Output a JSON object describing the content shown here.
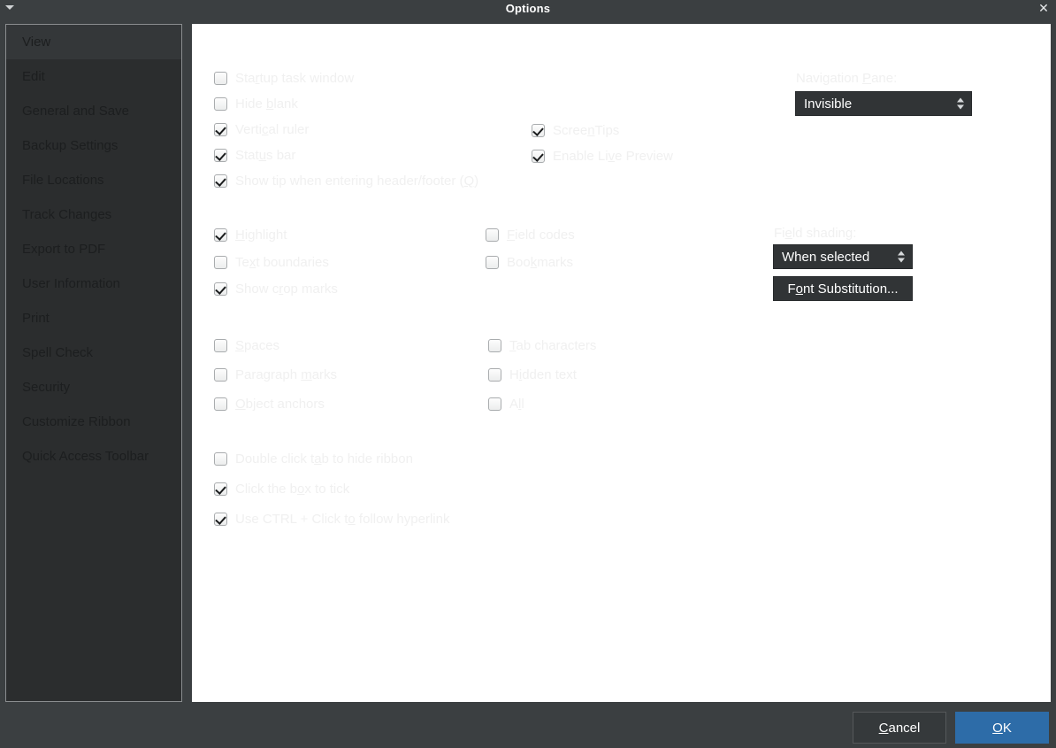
{
  "window": {
    "title": "Options",
    "menu_caret_icon": "chevron-down-icon",
    "close_icon": "close-icon",
    "accent_color": "#2d6ca8",
    "titlebar_color": "#3b3f41",
    "panel_color": "#ffffff",
    "sidebar_color": "#2b2d2e"
  },
  "sidebar": {
    "items": [
      {
        "label": "View",
        "selected": true
      },
      {
        "label": "Edit",
        "selected": false
      },
      {
        "label": "General and Save",
        "selected": false
      },
      {
        "label": "Backup Settings",
        "selected": false
      },
      {
        "label": "File Locations",
        "selected": false
      },
      {
        "label": "Track Changes",
        "selected": false
      },
      {
        "label": "Export to PDF",
        "selected": false
      },
      {
        "label": "User Information",
        "selected": false
      },
      {
        "label": "Print",
        "selected": false
      },
      {
        "label": "Spell Check",
        "selected": false
      },
      {
        "label": "Security",
        "selected": false
      },
      {
        "label": "Customize Ribbon",
        "selected": false
      },
      {
        "label": "Quick Access Toolbar",
        "selected": false
      }
    ]
  },
  "view_panel": {
    "group1_left": [
      {
        "label": "Startup task window",
        "accel": "r",
        "checked": false
      },
      {
        "label": "Hide blank",
        "accel": "b",
        "checked": false
      },
      {
        "label": "Vertical ruler",
        "accel": "c",
        "checked": true
      },
      {
        "label": "Status bar",
        "accel": "u",
        "checked": true
      },
      {
        "label": "Show tip when entering header/footer (Q)",
        "accel": "Q",
        "checked": true
      }
    ],
    "group1_right": [
      {
        "label": "ScreenTips",
        "accel": "n",
        "checked": true
      },
      {
        "label": "Enable Live Preview",
        "accel": "v",
        "checked": true
      }
    ],
    "group2_left": [
      {
        "label": "Highlight",
        "accel": "H",
        "checked": true
      },
      {
        "label": "Text boundaries",
        "accel": "x",
        "checked": false
      },
      {
        "label": "Show crop marks",
        "accel": "r",
        "checked": true
      }
    ],
    "group2_right": [
      {
        "label": "Field codes",
        "accel": "F",
        "checked": false
      },
      {
        "label": "Bookmarks",
        "accel": "k",
        "checked": false
      }
    ],
    "group3_left": [
      {
        "label": "Spaces",
        "accel": "S",
        "checked": false
      },
      {
        "label": "Paragraph marks",
        "accel": "m",
        "checked": false
      },
      {
        "label": "Object anchors",
        "accel": "O",
        "checked": false
      }
    ],
    "group3_right": [
      {
        "label": "Tab characters",
        "accel": "T",
        "checked": false
      },
      {
        "label": "Hidden text",
        "accel": "i",
        "checked": false
      },
      {
        "label": "All",
        "accel": "l",
        "checked": false
      }
    ],
    "group4": [
      {
        "label": "Double click tab to hide ribbon",
        "accel": "a",
        "checked": false
      },
      {
        "label": "Click the box to tick",
        "accel": "o",
        "checked": true
      },
      {
        "label": "Use CTRL + Click to follow hyperlink",
        "accel": "o",
        "checked": true
      }
    ],
    "navigation_pane": {
      "label": "Navigation Pane:",
      "accel": "P",
      "value": "Invisible"
    },
    "field_shading": {
      "label": "Field shading:",
      "accel": "e",
      "value": "When selected"
    },
    "font_substitution_button": {
      "label": "Font Substitution...",
      "accel": "o"
    }
  },
  "footer": {
    "cancel_label": "Cancel",
    "cancel_accel": "C",
    "ok_label": "OK",
    "ok_accel": "O"
  }
}
